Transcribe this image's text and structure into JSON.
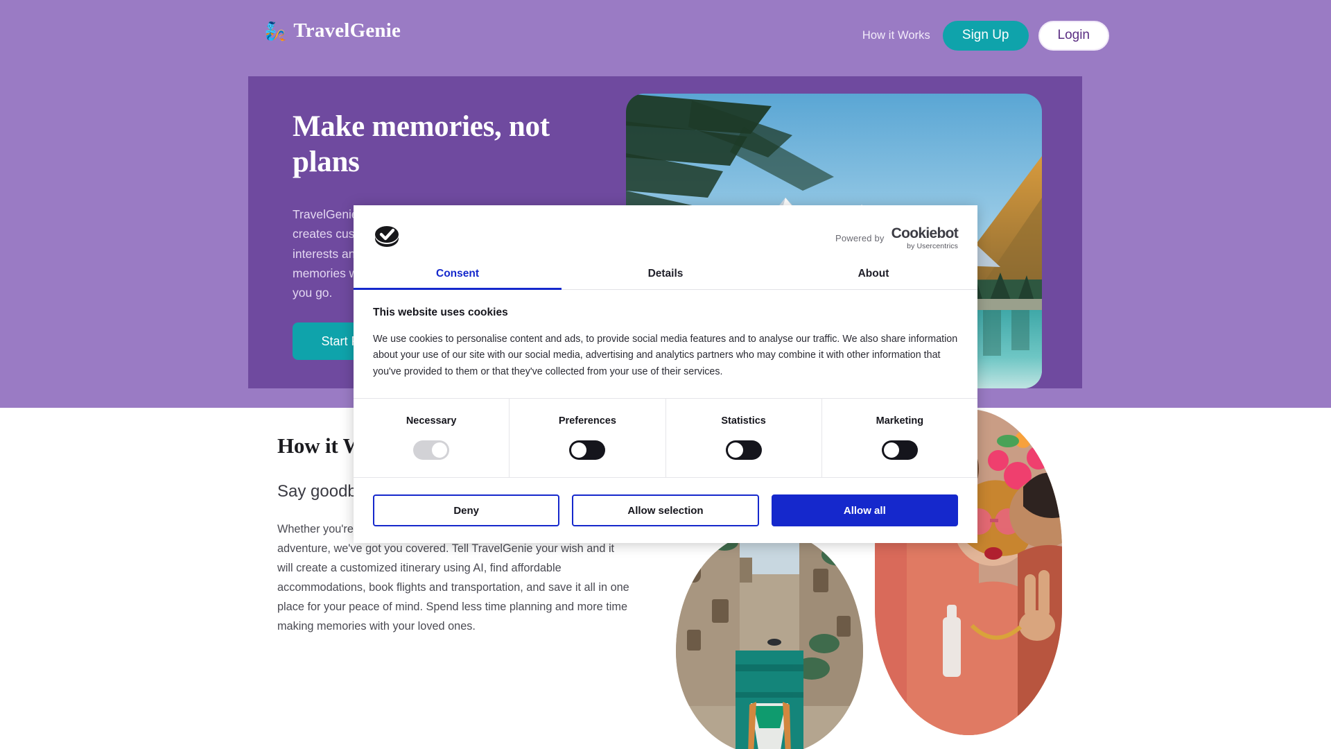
{
  "header": {
    "brand_mark": "genie-lamp-icon",
    "brand_name": "TravelGenie",
    "nav_link": "How it Works",
    "signup_label": "Sign Up",
    "login_label": "Login"
  },
  "hero": {
    "title": "Make memories, not plans",
    "copy": "TravelGenie is an AI travel planner that creates customized itineraries based on your interests and budget, so you can make memories with the people you love, wherever you go.",
    "cta_label": "Start Planning",
    "photo_alt": "mountain-lake-landscape"
  },
  "how_it_works": {
    "title": "How it Works",
    "subtitle": "Say goodbye to travel planning stress",
    "body": "Whether you're planning a weekend getaway or a month-long adventure, we've got you covered. Tell TravelGenie your wish and it will create a customized itinerary using AI, find affordable accommodations, book flights and transportation, and save it all in one place for your peace of mind. Spend less time planning and more time making memories with your loved ones.",
    "photo_left_alt": "venice-canal-boat",
    "photo_right_alt": "friends-celebrating"
  },
  "cookie_dialog": {
    "logo_icon": "cookiebot-checkmark-icon",
    "powered_by_label": "Powered by",
    "brand_word": "Cookiebot",
    "brand_sub": "by Usercentrics",
    "tabs": [
      {
        "label": "Consent",
        "active": true
      },
      {
        "label": "Details",
        "active": false
      },
      {
        "label": "About",
        "active": false
      }
    ],
    "heading": "This website uses cookies",
    "text": "We use cookies to personalise content and ads, to provide social media features and to analyse our traffic. We also share information about your use of our site with our social media, advertising and analytics partners who may combine it with other information that you've provided to them or that they've collected from your use of their services.",
    "categories": [
      {
        "label": "Necessary",
        "state": "on-locked"
      },
      {
        "label": "Preferences",
        "state": "off"
      },
      {
        "label": "Statistics",
        "state": "off"
      },
      {
        "label": "Marketing",
        "state": "off"
      }
    ],
    "buttons": {
      "deny": "Deny",
      "allow_selection": "Allow selection",
      "allow_all": "Allow all"
    }
  },
  "colors": {
    "page_purple": "#9a7bc4",
    "hero_purple": "#6f4a9f",
    "teal": "#0fa3ab",
    "consent_blue": "#1528cc",
    "toggle_off": "#15151c",
    "toggle_locked": "#d2d2d6"
  }
}
